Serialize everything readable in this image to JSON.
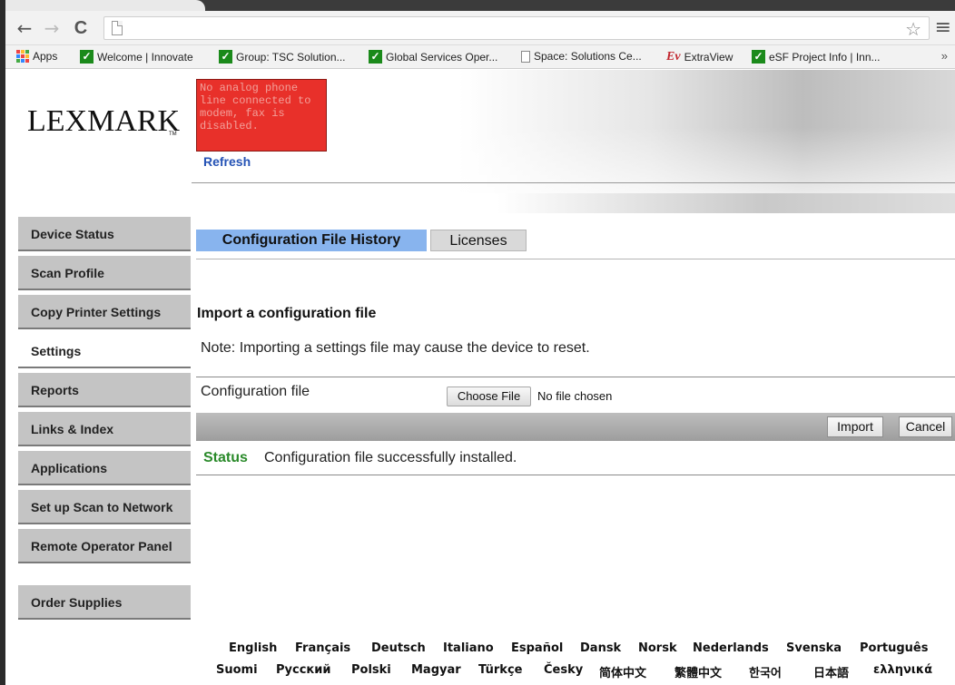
{
  "browser": {
    "back_glyph": "←",
    "forward_glyph": "→",
    "reload_glyph": "C",
    "star_glyph": "☆",
    "menu_glyph": "≡",
    "bookmarks": {
      "apps": "Apps",
      "items": [
        "Welcome | Innovate",
        "Group: TSC Solution...",
        "Global Services Oper...",
        "Space: Solutions Ce...",
        "ExtraView",
        "eSF Project Info | Inn..."
      ],
      "extraview_mark": "Ev",
      "check_mark": "✓",
      "overflow": "»"
    }
  },
  "header": {
    "logo_text": "LEXMARK",
    "logo_tm": "TM",
    "alert_text": "No analog phone line connected to modem, fax is disabled.",
    "refresh_label": "Refresh"
  },
  "sidebar": {
    "items": [
      {
        "label": "Device Status",
        "active": false
      },
      {
        "label": "Scan Profile",
        "active": false
      },
      {
        "label": "Copy Printer Settings",
        "active": false
      },
      {
        "label": "Settings",
        "active": true
      },
      {
        "label": "Reports",
        "active": false
      },
      {
        "label": "Links & Index",
        "active": false
      },
      {
        "label": "Applications",
        "active": false
      },
      {
        "label": "Set up Scan to Network",
        "active": false
      },
      {
        "label": "Remote Operator Panel",
        "active": false
      },
      {
        "label": "Order Supplies",
        "active": false
      }
    ]
  },
  "main": {
    "tabs": [
      {
        "label": "Configuration File History",
        "active": true
      },
      {
        "label": "Licenses",
        "active": false
      }
    ],
    "section_title": "Import a configuration file",
    "note": "Note: Importing a settings file may cause the device to reset.",
    "config_label": "Configuration file",
    "choose_file_label": "Choose File",
    "no_file_text": "No file chosen",
    "import_label": "Import",
    "cancel_label": "Cancel",
    "status_label": "Status",
    "status_text": "Configuration file successfully installed."
  },
  "languages": {
    "row1": [
      "English",
      "Français",
      "Deutsch",
      "Italiano",
      "Español",
      "Dansk",
      "Norsk",
      "Nederlands",
      "Svenska",
      "Português"
    ],
    "row2": [
      "Suomi",
      "Русский",
      "Polski",
      "Magyar",
      "Türkçe",
      "Česky",
      "简体中文",
      "繁體中文",
      "한국어",
      "日本語",
      "ελληνικά"
    ]
  },
  "colors": {
    "tab_active": "#88b4ee",
    "alert_bg": "#e8302a",
    "status_green": "#2a8a2a",
    "link_blue": "#2452b5"
  }
}
